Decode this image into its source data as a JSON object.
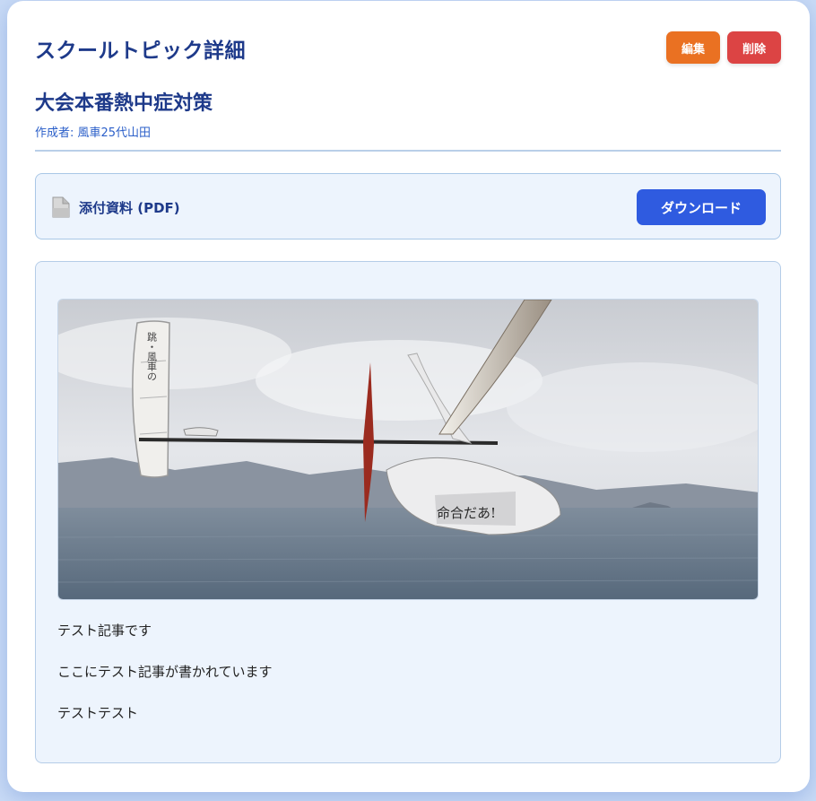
{
  "header": {
    "page_title": "スクールトピック詳細",
    "edit_label": "編集",
    "delete_label": "削除"
  },
  "topic": {
    "title": "大会本番熱中症対策",
    "author_label": "作成者: 風車25代山田"
  },
  "attachment": {
    "label": "添付資料 (PDF)",
    "icon": "document-icon",
    "download_label": "ダウンロード"
  },
  "content": {
    "image_text": {
      "fin_text": "跳・風車の",
      "fuselage_text": "命合だあ!"
    },
    "paragraphs": [
      "テスト記事です",
      "ここにテスト記事が書かれています",
      "テストテスト"
    ]
  },
  "colors": {
    "accent": "#1e3a8a",
    "edit": "#ea7122",
    "delete": "#dc4444",
    "download": "#2f5be0"
  }
}
